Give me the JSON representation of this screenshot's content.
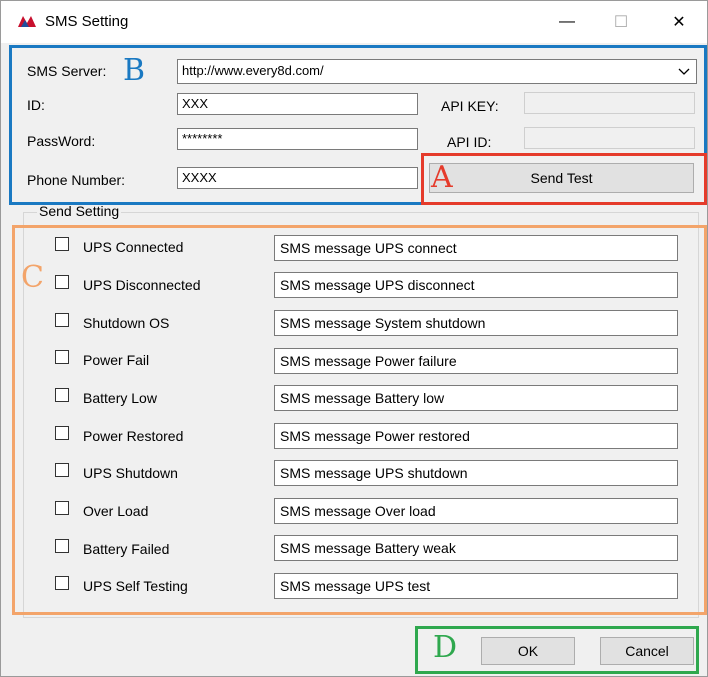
{
  "window": {
    "title": "SMS Setting",
    "minimize_glyph": "—",
    "maximize_glyph": "☐",
    "close_glyph": "✕",
    "icon": "sms-app-icon"
  },
  "server": {
    "label": "SMS Server:",
    "value": "http://www.every8d.com/",
    "dropdown_icon": "chevron-down-icon"
  },
  "credentials": {
    "id_label": "ID:",
    "id_value": "XXX",
    "password_label": "PassWord:",
    "password_value": "********",
    "phone_label": "Phone Number:",
    "phone_value": "XXXX",
    "api_key_label": "API KEY:",
    "api_key_value": "",
    "api_id_label": "API ID:",
    "api_id_value": ""
  },
  "send_test_label": "Send Test",
  "send_setting": {
    "title": "Send Setting",
    "rows": [
      {
        "label": "UPS Connected",
        "message": "SMS message UPS connect",
        "checked": false
      },
      {
        "label": "UPS Disconnected",
        "message": "SMS message UPS disconnect",
        "checked": false
      },
      {
        "label": "Shutdown OS",
        "message": "SMS message System shutdown",
        "checked": false
      },
      {
        "label": "Power Fail",
        "message": "SMS message Power failure",
        "checked": false
      },
      {
        "label": "Battery Low",
        "message": "SMS message Battery low",
        "checked": false
      },
      {
        "label": "Power Restored",
        "message": "SMS message Power restored",
        "checked": false
      },
      {
        "label": "UPS Shutdown",
        "message": "SMS message UPS shutdown",
        "checked": false
      },
      {
        "label": "Over Load",
        "message": "SMS message Over load",
        "checked": false
      },
      {
        "label": "Battery Failed",
        "message": "SMS message Battery weak",
        "checked": false
      },
      {
        "label": "UPS Self Testing",
        "message": "SMS message UPS test",
        "checked": false
      }
    ]
  },
  "buttons": {
    "ok": "OK",
    "cancel": "Cancel"
  },
  "annotations": {
    "A": {
      "letter": "A",
      "color": "#e53b2b"
    },
    "B": {
      "letter": "B",
      "color": "#1a79c2"
    },
    "C": {
      "letter": "C",
      "color": "#f3a46a"
    },
    "D": {
      "letter": "D",
      "color": "#2fa84e"
    }
  }
}
